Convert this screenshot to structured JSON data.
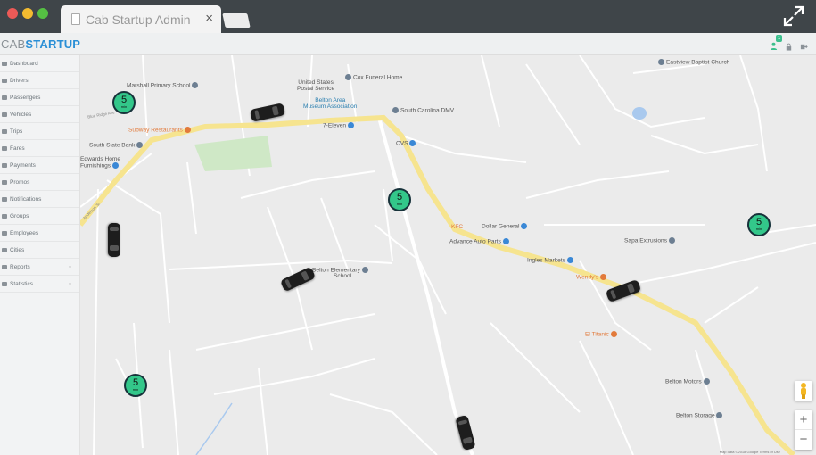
{
  "browser": {
    "tab_title": "Cab Startup Admin",
    "tab_close": "×"
  },
  "app": {
    "logo_part1": "CAB",
    "logo_part2": "STARTUP",
    "notification_count": "1"
  },
  "sidebar": {
    "items": [
      {
        "label": "Dashboard"
      },
      {
        "label": "Drivers"
      },
      {
        "label": "Passengers"
      },
      {
        "label": "Vehicles"
      },
      {
        "label": "Trips"
      },
      {
        "label": "Fares"
      },
      {
        "label": "Payments"
      },
      {
        "label": "Promos"
      },
      {
        "label": "Notifications"
      },
      {
        "label": "Groups"
      },
      {
        "label": "Employees"
      },
      {
        "label": "Cities"
      },
      {
        "label": "Reports",
        "expandable": true
      },
      {
        "label": "Statistics",
        "expandable": true
      }
    ]
  },
  "map": {
    "places": {
      "eastview": "Eastview Baptist Church",
      "marshall": "Marshall Primary School",
      "post_office_1": "United States",
      "post_office_2": "Postal Service",
      "cox": "Cox Funeral Home",
      "belton_museum_1": "Belton Area",
      "belton_museum_2": "Museum Association",
      "dmv": "South Carolina DMV",
      "subway": "Subway Restaurants",
      "seven_eleven": "7-Eleven",
      "state_bank": "South State Bank",
      "furnishings_1": "Edwards Home",
      "furnishings_2": "Furnishings",
      "cvs": "CVS",
      "kfc": "KFC",
      "dollar_general": "Dollar General",
      "advance_auto": "Advance Auto Parts",
      "sapa": "Sapa Extrusions",
      "ingles": "Ingles Markets",
      "wendys": "Wendy's",
      "belton_elementary_1": "Belton Elementary",
      "belton_elementary_2": "School",
      "el_titanic": "El Titanic",
      "belton_motors": "Belton Motors",
      "belton_storage": "Belton Storage"
    },
    "streets": {
      "anderson": "Anderson St",
      "blue_ridge": "Blue Ridge Ave"
    },
    "pins": [
      {
        "value": "5",
        "unit": "min"
      },
      {
        "value": "5",
        "unit": "min"
      },
      {
        "value": "5",
        "unit": "min"
      },
      {
        "value": "5",
        "unit": "min"
      }
    ],
    "zoom_in": "+",
    "zoom_out": "−",
    "footer": "Map data ©2018 Google  Terms of Use"
  },
  "colors": {
    "accent": "#2a8fd6",
    "pin_fill": "#33c78a",
    "pin_dark": "#17323a",
    "highway": "#f6e48f"
  }
}
